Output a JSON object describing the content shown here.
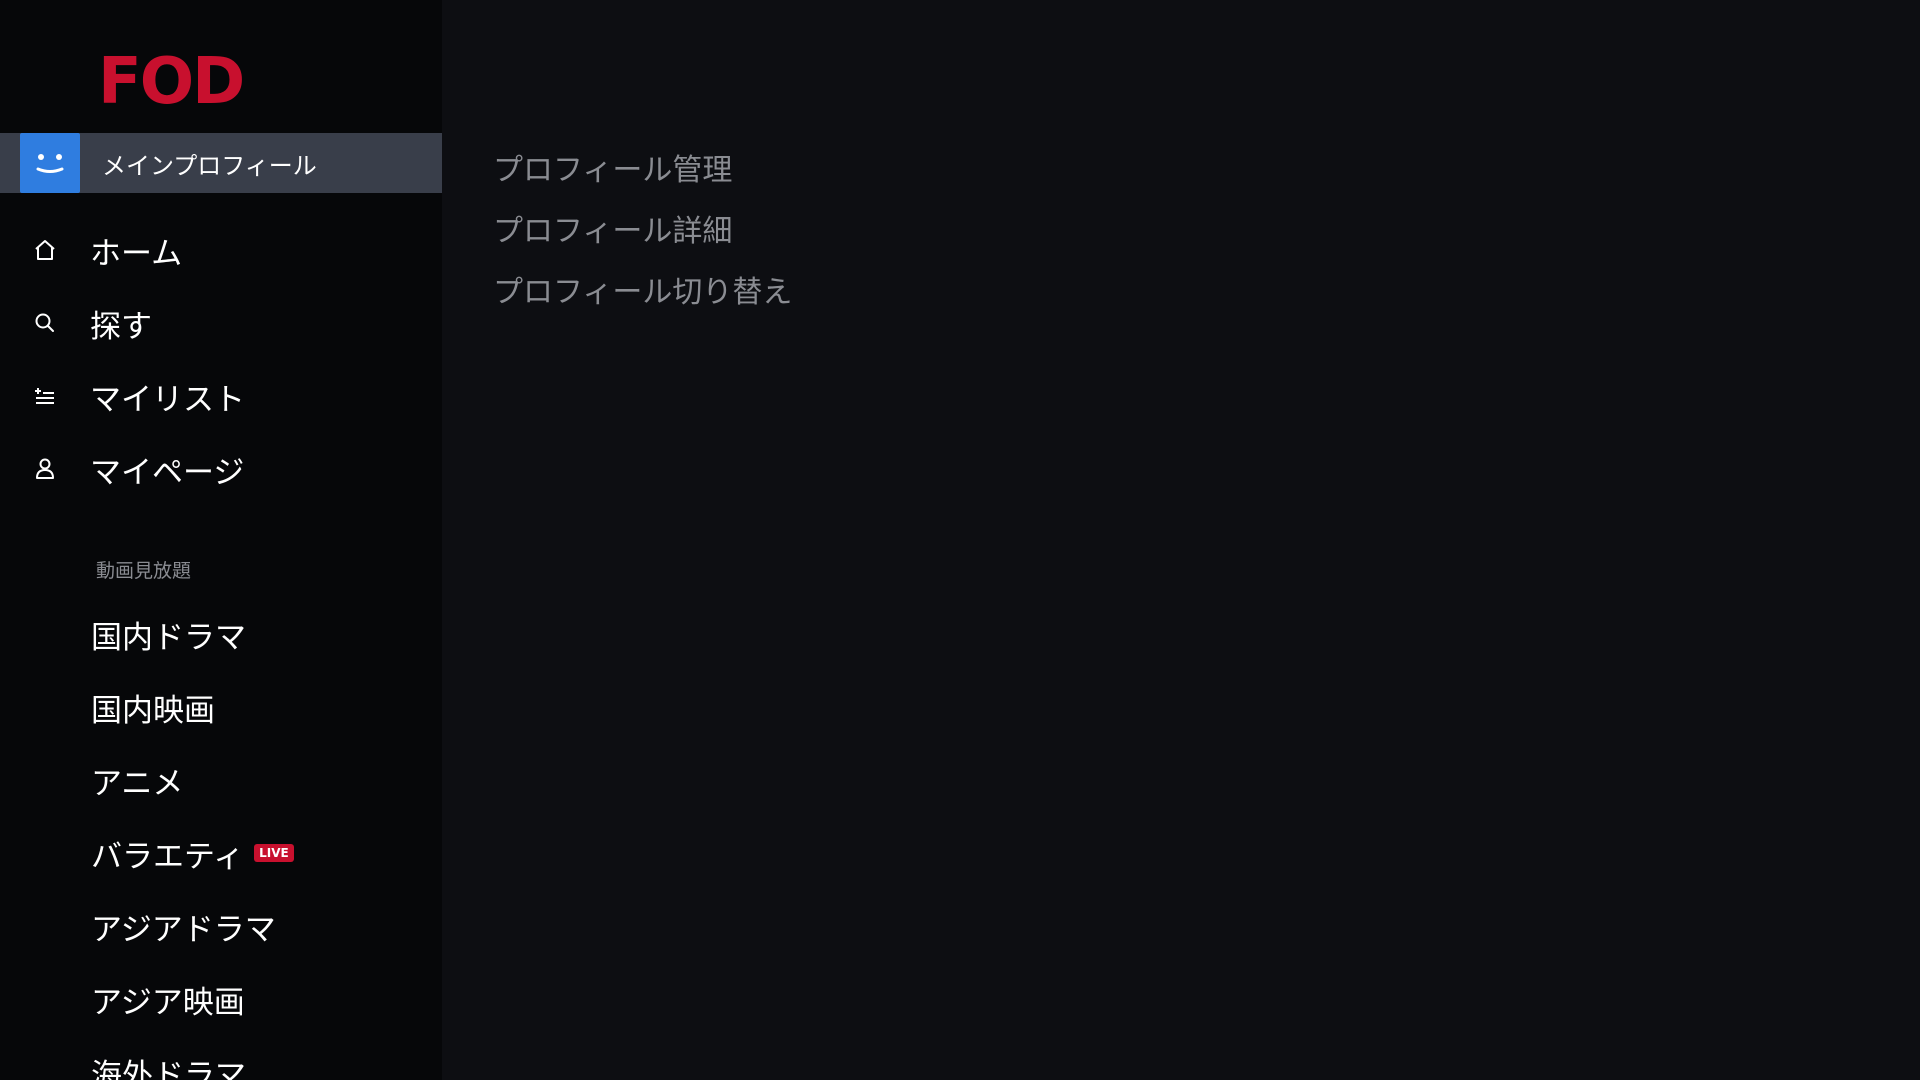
{
  "brand": {
    "logo_text": "FOD",
    "accent_color": "#c8102e"
  },
  "profile": {
    "name": "メインプロフィール",
    "avatar_icon": "smiley-face-icon",
    "avatar_color": "#2f7de0"
  },
  "nav": [
    {
      "label": "ホーム",
      "icon": "home-icon"
    },
    {
      "label": "探す",
      "icon": "search-icon"
    },
    {
      "label": "マイリスト",
      "icon": "add-list-icon"
    },
    {
      "label": "マイページ",
      "icon": "person-icon"
    }
  ],
  "section": {
    "header": "動画見放題",
    "items": [
      {
        "label": "国内ドラマ"
      },
      {
        "label": "国内映画"
      },
      {
        "label": "アニメ"
      },
      {
        "label": "バラエティ",
        "badge": "LIVE"
      },
      {
        "label": "アジアドラマ"
      },
      {
        "label": "アジア映画"
      },
      {
        "label": "海外ドラマ"
      }
    ]
  },
  "profile_menu": [
    {
      "label": "プロフィール管理"
    },
    {
      "label": "プロフィール詳細"
    },
    {
      "label": "プロフィール切り替え"
    }
  ]
}
